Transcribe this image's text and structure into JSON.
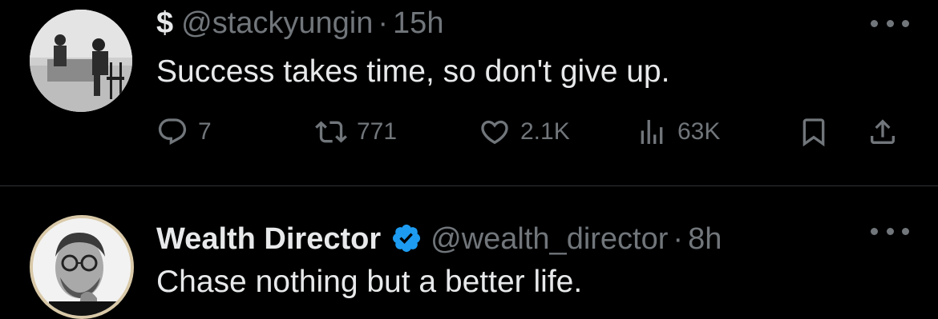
{
  "tweets": [
    {
      "display_name": "$",
      "handle": "@stackyungin",
      "separator": "·",
      "time": "15h",
      "verified": false,
      "text": "Success takes time, so don't give up.",
      "actions": {
        "replies": "7",
        "retweets": "771",
        "likes": "2.1K",
        "views": "63K"
      }
    },
    {
      "display_name": "Wealth Director",
      "handle": "@wealth_director",
      "separator": "·",
      "time": "8h",
      "verified": true,
      "text": "Chase nothing but a better life."
    }
  ],
  "colors": {
    "background": "#000000",
    "primary_text": "#e7e9ea",
    "secondary_text": "#71767b",
    "verified_badge": "#1d9bf0",
    "divider": "#2f3336"
  },
  "icons": [
    "reply-icon",
    "retweet-icon",
    "like-icon",
    "views-icon",
    "bookmark-icon",
    "share-icon",
    "more-icon",
    "verified-badge-icon"
  ]
}
